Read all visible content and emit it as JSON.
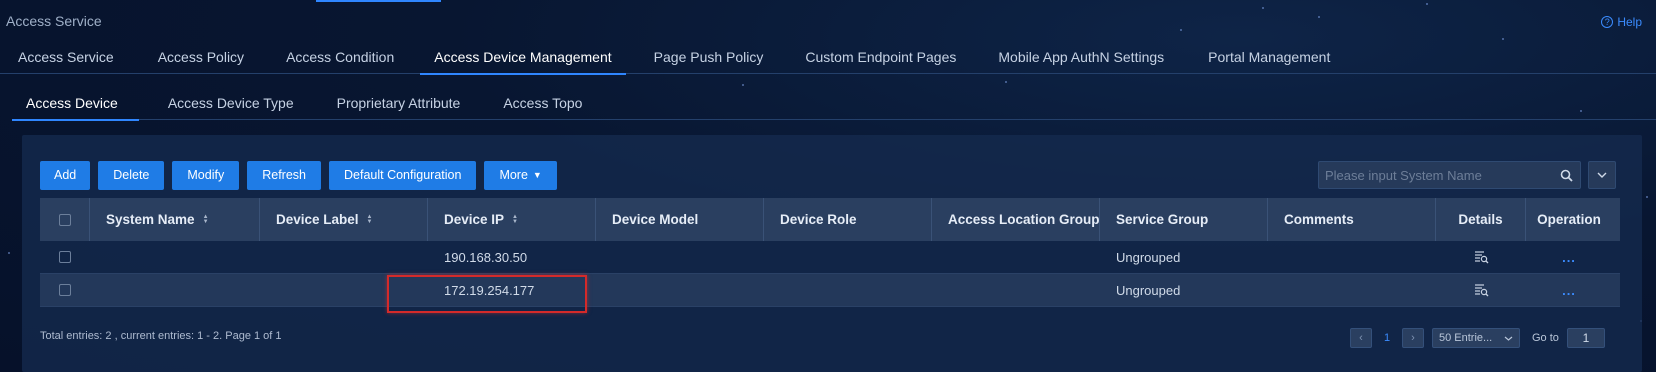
{
  "app": {
    "title": "Access Service",
    "help_label": "Help"
  },
  "main_tabs": [
    {
      "label": "Access Service"
    },
    {
      "label": "Access Policy"
    },
    {
      "label": "Access Condition"
    },
    {
      "label": "Access Device Management",
      "active": true
    },
    {
      "label": "Page Push Policy"
    },
    {
      "label": "Custom Endpoint Pages"
    },
    {
      "label": "Mobile App AuthN Settings"
    },
    {
      "label": "Portal Management"
    }
  ],
  "sub_tabs": [
    {
      "label": "Access Device",
      "active": true
    },
    {
      "label": "Access Device Type"
    },
    {
      "label": "Proprietary Attribute"
    },
    {
      "label": "Access Topo"
    }
  ],
  "toolbar": {
    "add": "Add",
    "delete": "Delete",
    "modify": "Modify",
    "refresh": "Refresh",
    "default_config": "Default Configuration",
    "more": "More"
  },
  "search": {
    "placeholder": "Please input System Name"
  },
  "table": {
    "columns": [
      "System Name",
      "Device Label",
      "Device IP",
      "Device Model",
      "Device Role",
      "Access Location Group",
      "Service Group",
      "Comments",
      "Details",
      "Operation"
    ],
    "rows": [
      {
        "system_name": "",
        "device_label": "",
        "device_ip": "190.168.30.50",
        "device_model": "",
        "device_role": "",
        "access_location_group": "",
        "service_group": "Ungrouped",
        "comments": "",
        "operation": "..."
      },
      {
        "system_name": "",
        "device_label": "",
        "device_ip": "172.19.254.177",
        "device_model": "",
        "device_role": "",
        "access_location_group": "",
        "service_group": "Ungrouped",
        "comments": "",
        "operation": "..."
      }
    ]
  },
  "footer": {
    "summary": "Total entries: 2 , current entries: 1 - 2. Page 1 of 1",
    "current_page": "1",
    "page_size": "50 Entrie...",
    "goto_label": "Go to",
    "goto_value": "1"
  },
  "colors": {
    "accent": "#2f86ff",
    "button": "#1f7ce6",
    "highlight": "#d42a2a"
  }
}
